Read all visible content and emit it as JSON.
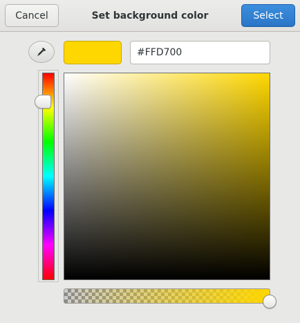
{
  "dialog": {
    "title": "Set background color",
    "cancel_label": "Cancel",
    "select_label": "Select"
  },
  "color": {
    "hex": "#FFD700",
    "hue_level": 0.14,
    "saturation": 1.0,
    "value": 1.0,
    "alpha": 1.0
  },
  "icons": {
    "picker": "color-picker-icon"
  },
  "colors": {
    "accent": "#3584e4",
    "current": "#ffd700",
    "plane_hue": "#ffd700"
  }
}
